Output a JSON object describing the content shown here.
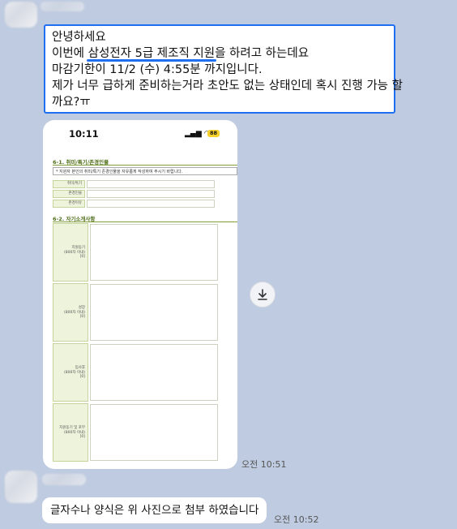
{
  "messages": [
    {
      "lines": [
        "안녕하세요",
        "삼성전자 5급 제조직 지원",
        "마감기한이 11/2 (수) 4:55분 까지입니다.",
        "제가 너무 급하게 준비하는거라 초안도 없는 상태인데 혹시 진행 가능 할",
        "까요?ㅠ"
      ],
      "line2_prefix": "이번에 ",
      "line2_suffix": "을 하려고 하는데요"
    }
  ],
  "photo": {
    "status_time": "10:11",
    "battery": "88",
    "section1_title": "6-1. 취미/특기/존경인물",
    "note": "* 지원자 본인의 취미/특기 존경인물을 자유롭게 작성하여 주시기 바랍니다.",
    "fields": [
      "취미/특기",
      "존경인물",
      "존경이유"
    ],
    "section2_title": "6-2. 자기소개사항",
    "blocks": [
      {
        "label": "지원동기",
        "sub": "(800자 이내)",
        "code": "[0]"
      },
      {
        "label": "성장",
        "sub": "(800자 이내)",
        "code": "[0]"
      },
      {
        "label": "입사후",
        "sub": "(800자 이내)",
        "code": "[0]"
      },
      {
        "label": "지원동기 및 포부",
        "sub": "(800자 이내)",
        "code": "[0]"
      }
    ]
  },
  "timestamps": {
    "photo": "오전 10:51",
    "msg2": "오전 10:52"
  },
  "msg2": "글자수나 양식은 위 사진으로 첨부 하였습니다",
  "colors": {
    "background": "#bfcbe0",
    "highlight": "#1f6ff2",
    "form_green": "#4e6d16"
  }
}
